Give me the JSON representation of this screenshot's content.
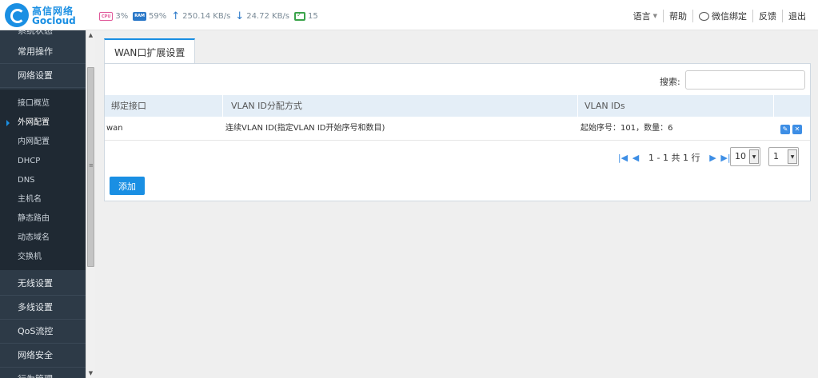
{
  "brand": {
    "name_cn": "高信网络",
    "name_en": "Gocloud"
  },
  "stats": {
    "cpu_chip": "CPU",
    "cpu": "3%",
    "ram_chip": "RAM",
    "ram": "59%",
    "upload": "250.14 KB/s",
    "download": "24.72 KB/s",
    "terminals": "15"
  },
  "topnav": {
    "language": "语言",
    "help": "帮助",
    "wechat": "微信绑定",
    "feedback": "反馈",
    "logout": "退出"
  },
  "sidebar": {
    "cut_item": "系统状态",
    "main_items": [
      "常用操作",
      "网络设置"
    ],
    "sub_items": [
      "接口概览",
      "外网配置",
      "内网配置",
      "DHCP",
      "DNS",
      "主机名",
      "静态路由",
      "动态域名",
      "交换机"
    ],
    "active_sub": "外网配置",
    "bottom_items": [
      "无线设置",
      "多线设置",
      "QoS流控",
      "网络安全",
      "行为管理"
    ]
  },
  "tab": {
    "label": "WAN口扩展设置"
  },
  "search": {
    "label": "搜索:",
    "value": ""
  },
  "table": {
    "headers": [
      "绑定接口",
      "VLAN ID分配方式",
      "VLAN IDs"
    ],
    "rows": [
      {
        "iface": "wan",
        "method": "连续VLAN ID(指定VLAN ID开始序号和数目)",
        "ids": "起始序号：101，数量：6"
      }
    ]
  },
  "pager": {
    "text": "1 - 1 共 1 行",
    "page_size": "10",
    "page": "1"
  },
  "buttons": {
    "add": "添加"
  },
  "colors": {
    "accent": "#1a8fe3",
    "sidebar": "#2d3a47"
  }
}
